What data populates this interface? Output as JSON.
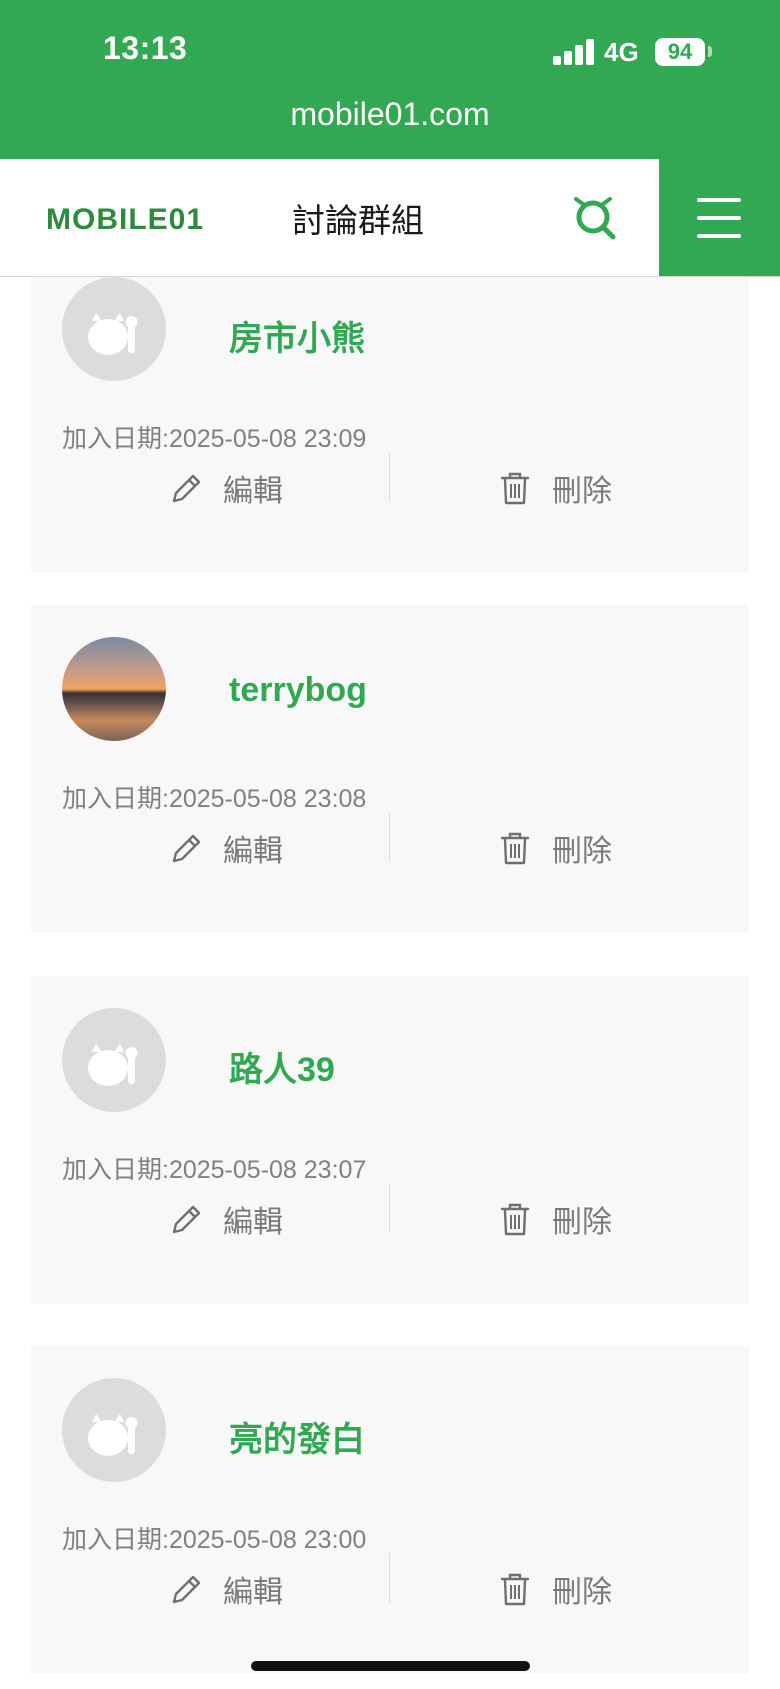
{
  "status_bar": {
    "time": "13:13",
    "network": "4G",
    "battery": "94",
    "url": "mobile01.com"
  },
  "header": {
    "logo_text": "MOBILE01",
    "title": "討論群組",
    "search_icon": "search-icon",
    "menu_icon": "hamburger-menu-icon"
  },
  "colors": {
    "brand_green": "#33a852",
    "card_bg": "#f8f8f8",
    "muted_text": "#808080"
  },
  "members": [
    {
      "name": "房市小熊",
      "joined": "加入日期:2025-05-08 23:09",
      "avatar": "default",
      "edit_label": "編輯",
      "delete_label": "刪除"
    },
    {
      "name": "terrybog",
      "joined": "加入日期:2025-05-08 23:08",
      "avatar": "photo",
      "edit_label": "編輯",
      "delete_label": "刪除"
    },
    {
      "name": "路人39",
      "joined": "加入日期:2025-05-08 23:07",
      "avatar": "default",
      "edit_label": "編輯",
      "delete_label": "刪除"
    },
    {
      "name": "亮的發白",
      "joined": "加入日期:2025-05-08 23:00",
      "avatar": "default",
      "edit_label": "編輯",
      "delete_label": "刪除"
    }
  ]
}
